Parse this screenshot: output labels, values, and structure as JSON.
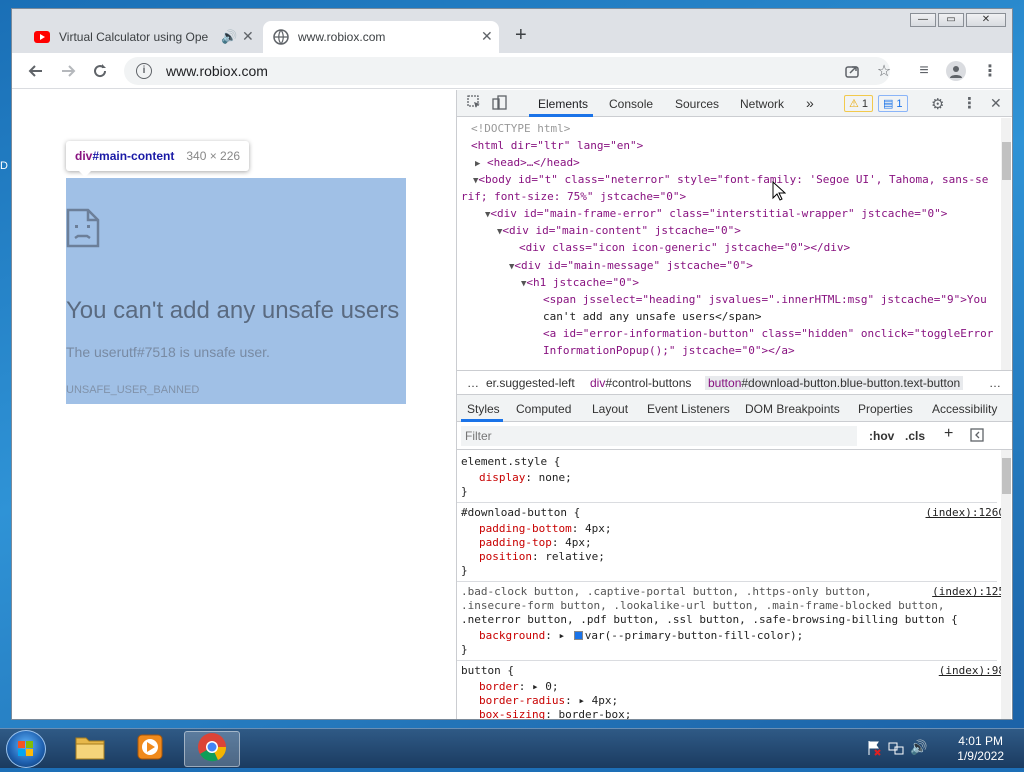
{
  "desktop": {
    "edge_label": "D"
  },
  "browser": {
    "tabs": [
      {
        "title": "Virtual Calculator using Ope",
        "favicon": "youtube-icon",
        "active": false
      },
      {
        "title": "www.robiox.com",
        "favicon": "globe-icon",
        "active": true
      }
    ],
    "window_buttons": {
      "minimize": "—",
      "maximize": "▭",
      "close": "✕"
    },
    "address": "www.robiox.com"
  },
  "page": {
    "tooltip": {
      "tag": "div",
      "id": "#main-content",
      "size": "340 × 226"
    },
    "error_title": "You can't add any unsafe users",
    "error_message": "The userutf#7518 is unsafe user.",
    "error_code": "UNSAFE_USER_BANNED"
  },
  "devtools": {
    "tabs": [
      "Elements",
      "Console",
      "Sources",
      "Network"
    ],
    "more": "»",
    "warnings": "1",
    "messages": "1",
    "elements_lines": {
      "doctype": "<!DOCTYPE html>",
      "html_open": "<html dir=\"ltr\" lang=\"en\">",
      "head": "<head>…</head>",
      "body_1": "<body id=\"t\" class=\"neterror\" style=\"font-family: 'Segoe UI', Tahoma, sans-se",
      "body_2": "rif; font-size: 75%\" jstcache=\"0\">",
      "main_frame": "<div id=\"main-frame-error\" class=\"interstitial-wrapper\" jstcache=\"0\">",
      "main_content": "<div id=\"main-content\" jstcache=\"0\">",
      "icon_div": "<div class=\"icon icon-generic\" jstcache=\"0\"></div>",
      "main_message": "<div id=\"main-message\" jstcache=\"0\">",
      "h1": "<h1 jstcache=\"0\">",
      "span_1": "<span jsselect=\"heading\" jsvalues=\".innerHTML:msg\" jstcache=\"9\">You",
      "span_2": "can't add any unsafe users</span>",
      "a_1": "<a id=\"error-information-button\" class=\"hidden\" onclick=\"toggleError",
      "a_2": "InformationPopup();\" jstcache=\"0\"></a>"
    },
    "breadcrumbs": {
      "dots": "…",
      "item1": "er.suggested-left",
      "item2_tag": "div",
      "item2": "#control-buttons",
      "item3_tag": "button",
      "item3": "#download-button.blue-button.text-button",
      "end": "…"
    },
    "subtabs": [
      "Styles",
      "Computed",
      "Layout",
      "Event Listeners",
      "DOM Breakpoints",
      "Properties",
      "Accessibility"
    ],
    "filter_placeholder": "Filter",
    "hov": ":hov",
    "cls": ".cls",
    "plus": "+",
    "rules": {
      "r1_sel": "element.style {",
      "r1_p1": "display: none;",
      "r2_sel": "#download-button {",
      "r2_src": "(index):1260",
      "r2_p1": "padding-bottom: 4px;",
      "r2_p2": "padding-top: 4px;",
      "r2_p3": "position: relative;",
      "r3_sel1": ".bad-clock button, .captive-portal button, .https-only button,",
      "r3_sel2": ".insecure-form button, .lookalike-url button, .main-frame-blocked button,",
      "r3_sel3": ".neterror button, .pdf button, .ssl button, .safe-browsing-billing button {",
      "r3_src": "(index):125",
      "r3_p1": "background: ▸ var(--primary-button-fill-color);",
      "r4_sel": "button {",
      "r4_src": "(index):98",
      "r4_p1": "border: ▸ 0;",
      "r4_p2": "border-radius: ▸ 4px;",
      "r4_p3": "box-sizing: border-box;",
      "close": "}"
    }
  },
  "taskbar": {
    "time": "4:01 PM",
    "date": "1/9/2022"
  }
}
